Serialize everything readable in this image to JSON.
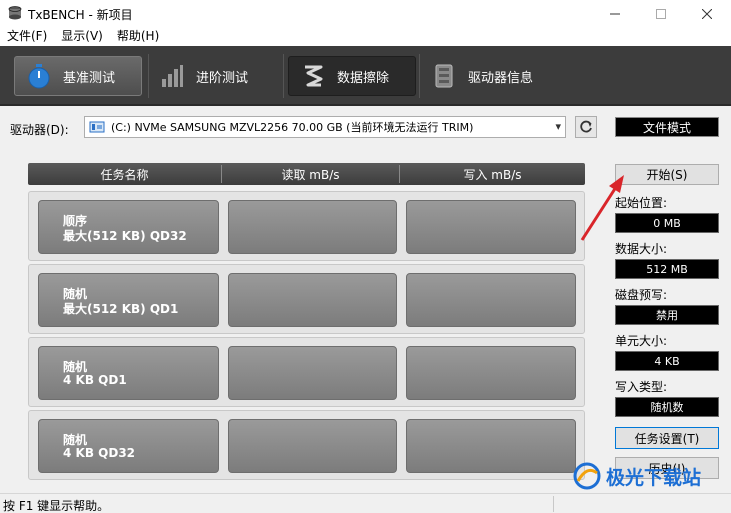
{
  "window": {
    "title": "TxBENCH - 新项目"
  },
  "menu": {
    "items": [
      "文件(F)",
      "显示(V)",
      "帮助(H)"
    ]
  },
  "toolbar": {
    "tabs": [
      {
        "label": "基准测试"
      },
      {
        "label": "进阶测试"
      },
      {
        "label": "数据擦除"
      },
      {
        "label": "驱动器信息"
      }
    ]
  },
  "drive": {
    "label": "驱动器(D):",
    "selected": "(C:) NVMe SAMSUNG MZVL2256  70.00 GB (当前环境无法运行 TRIM)",
    "mode": "文件模式"
  },
  "table": {
    "headers": [
      "任务名称",
      "读取 mB/s",
      "写入 mB/s"
    ],
    "rows": [
      {
        "line1": "顺序",
        "line2": "最大(512 KB) QD32"
      },
      {
        "line1": "随机",
        "line2": "最大(512 KB) QD1"
      },
      {
        "line1": "随机",
        "line2": "4 KB QD1"
      },
      {
        "line1": "随机",
        "line2": "4 KB QD32"
      }
    ]
  },
  "panel": {
    "start": "开始(S)",
    "start_pos_label": "起始位置:",
    "start_pos_value": "0 MB",
    "data_size_label": "数据大小:",
    "data_size_value": "512 MB",
    "precondition_label": "磁盘预写:",
    "precondition_value": "禁用",
    "unit_size_label": "单元大小:",
    "unit_size_value": "4 KB",
    "write_type_label": "写入类型:",
    "write_type_value": "随机数",
    "task_settings": "任务设置(T)",
    "history": "历史(I)"
  },
  "status": {
    "text": "按 F1 键显示帮助。"
  },
  "watermark": {
    "text": "极光下载站"
  },
  "colors": {
    "annotation_arrow": "#d9252a",
    "toolbar_bg": "#3c3c3c"
  }
}
